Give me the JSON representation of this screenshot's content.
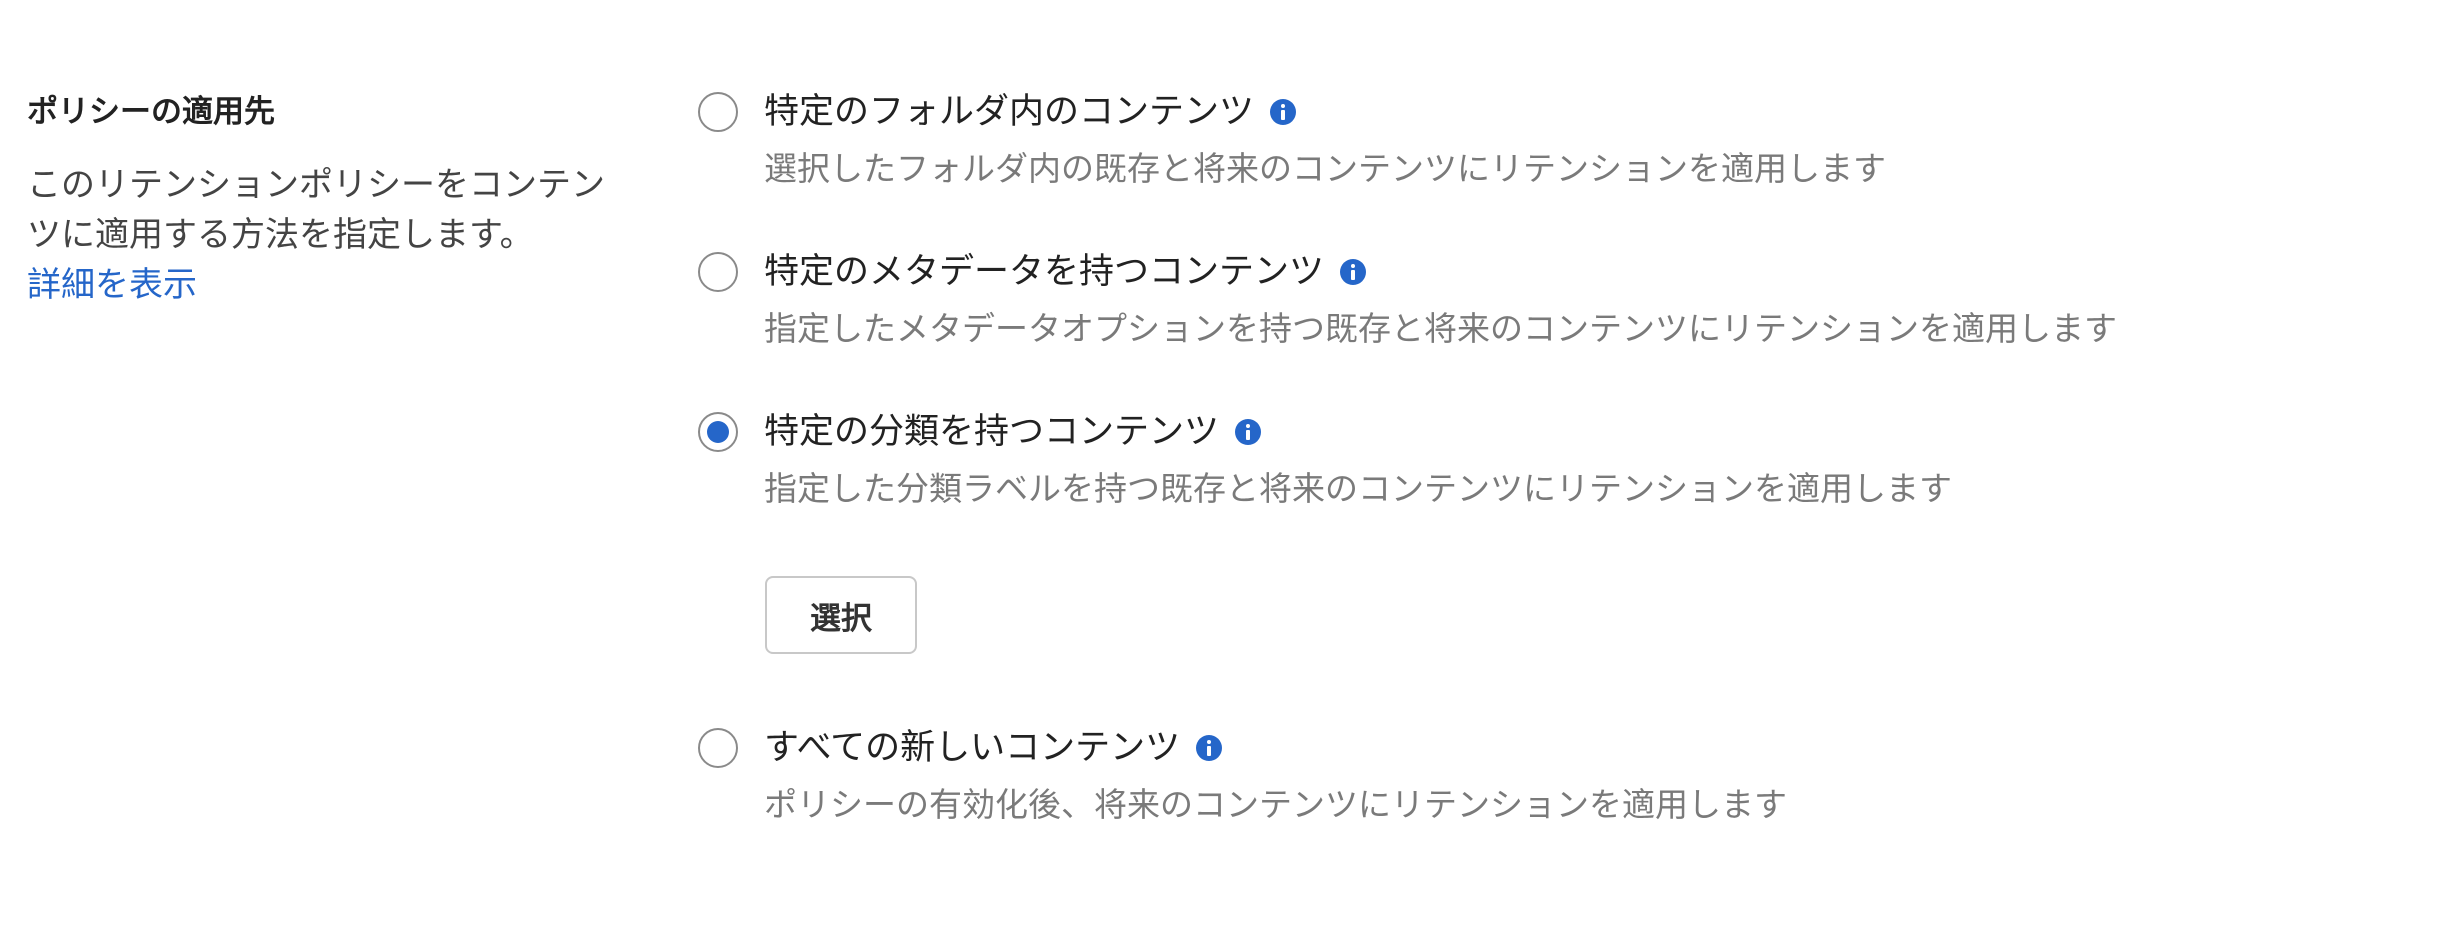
{
  "section": {
    "title": "ポリシーの適用先",
    "description": "このリテンションポリシーをコンテンツに適用する方法を指定します。",
    "learn_more": "詳細を表示"
  },
  "options": [
    {
      "label": "特定のフォルダ内のコンテンツ",
      "description": "選択したフォルダ内の既存と将来のコンテンツにリテンションを適用します",
      "checked": false,
      "info_icon": "info-icon"
    },
    {
      "label": "特定のメタデータを持つコンテンツ",
      "description": "指定したメタデータオプションを持つ既存と将来のコンテンツにリテンションを適用します",
      "checked": false,
      "info_icon": "info-icon"
    },
    {
      "label": "特定の分類を持つコンテンツ",
      "description": "指定した分類ラベルを持つ既存と将来のコンテンツにリテンションを適用します",
      "checked": true,
      "info_icon": "info-icon"
    },
    {
      "label": "すべての新しいコンテンツ",
      "description": "ポリシーの有効化後、将来のコンテンツにリテンションを適用します",
      "checked": false,
      "info_icon": "info-icon"
    }
  ],
  "select_button": {
    "label": "選択"
  },
  "colors": {
    "accent": "#2566c9",
    "text_primary": "#222222",
    "text_secondary": "#7a7a7a"
  }
}
